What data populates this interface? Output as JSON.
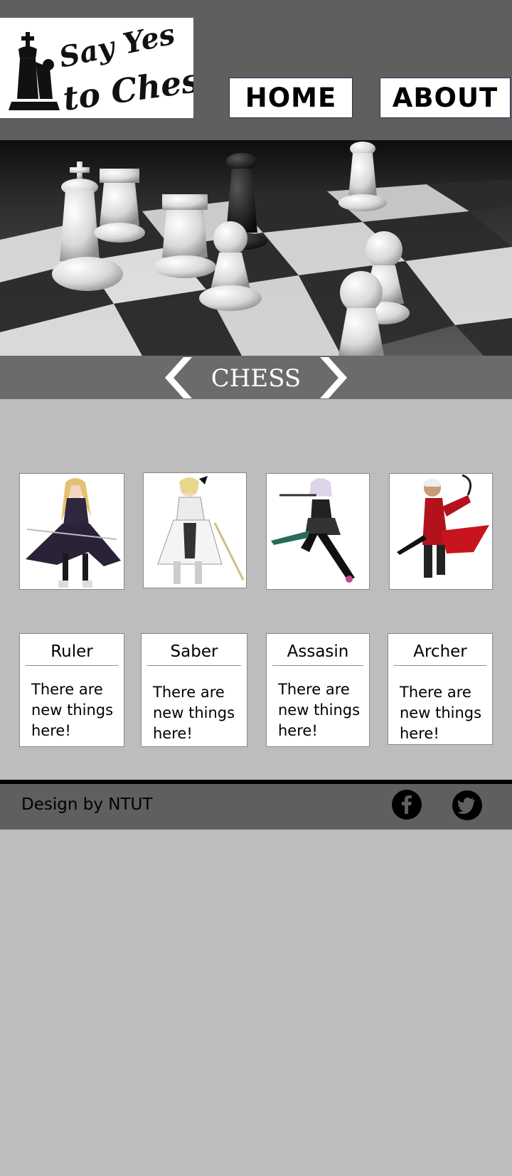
{
  "logo": {
    "line1": "Say Yes",
    "line2": "to Chess"
  },
  "nav": {
    "home": "HOME",
    "about": "ABOUT"
  },
  "banner": {
    "title": "CHESS"
  },
  "cards": [
    {
      "title": "Ruler",
      "text": "There are new things here!"
    },
    {
      "title": "Saber",
      "text": "There are new things here!"
    },
    {
      "title": "Assasin",
      "text": "There are new things here!"
    },
    {
      "title": "Archer",
      "text": "There are new things here!"
    }
  ],
  "footer": {
    "credit": "Design by NTUT"
  },
  "icons": {
    "facebook": "facebook-icon",
    "twitter": "twitter-icon"
  }
}
